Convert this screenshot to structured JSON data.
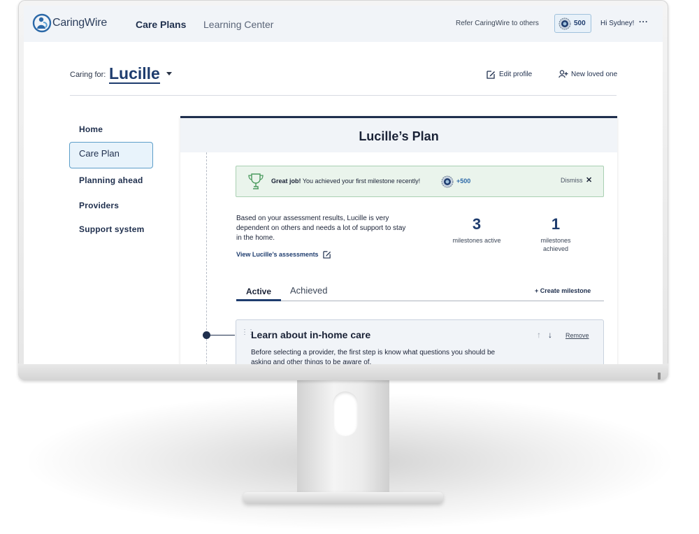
{
  "header": {
    "logo_text": "CaringWire",
    "nav": [
      "Care Plans",
      "Learning Center"
    ],
    "refer_text": "Refer CaringWire to others",
    "points": "500",
    "greeting": "Hi Sydney!",
    "more_menu": "···"
  },
  "profile": {
    "caring_for_label": "Caring for:",
    "loved_one_name": "Lucille",
    "edit_profile_label": "Edit profile",
    "new_loved_one_label": "New loved one"
  },
  "sidebar": {
    "items": [
      {
        "label": "Home",
        "active": false
      },
      {
        "label": "Care Plan",
        "active": true
      },
      {
        "label": "Planning ahead",
        "active": false
      },
      {
        "label": "Providers",
        "active": false
      },
      {
        "label": "Support system",
        "active": false
      }
    ]
  },
  "plan": {
    "title": "Lucille’s Plan",
    "banner": {
      "bold": "Great job!",
      "message": "You achieved your first milestone recently!",
      "points": "+500",
      "dismiss": "Dismiss",
      "close_glyph": "✕"
    },
    "assessment_text": "Based on your assessment results, Lucille is very dependent on others and needs a lot of support to stay in the home.",
    "view_assessments_link": "View Lucille’s assessments",
    "stats": [
      {
        "value": "3",
        "label": "milestones active"
      },
      {
        "value": "1",
        "label": "milestones achieved"
      }
    ],
    "tabs": {
      "active": "Active",
      "achieved": "Achieved",
      "create_milestone": "+ Create milestone"
    },
    "milestone": {
      "title": "Learn about in-home care",
      "description": "Before selecting a provider, the first step is know what questions you should be asking and other things to be aware of.",
      "remove": "Remove",
      "up_glyph": "↑",
      "down_glyph": "↓"
    }
  },
  "colors": {
    "navy": "#1e3c6e",
    "nav_bg": "#f1f4f8",
    "banner_bg": "#eaf4ec",
    "active_sidebar_bg": "#e8f3fb",
    "active_sidebar_border": "#5d9ec9"
  }
}
